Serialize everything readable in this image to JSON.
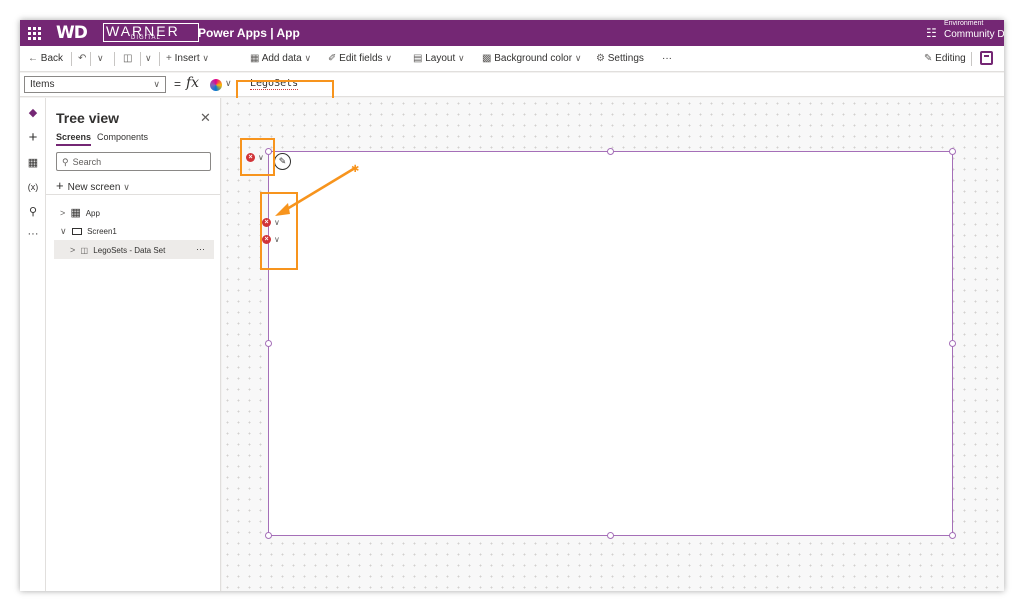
{
  "header": {
    "logo_wd": "WD",
    "logo_word": "WARNER",
    "logo_sub": "DIGITAL",
    "app_title": "Power Apps | App",
    "environment_label": "Environment",
    "environment_name": "Community Dev"
  },
  "commandbar": {
    "back": "Back",
    "insert": "Insert",
    "add_data": "Add data",
    "edit_fields": "Edit fields",
    "layout": "Layout",
    "background_color": "Background color",
    "settings": "Settings",
    "more": "···",
    "editing": "Editing"
  },
  "formulabar": {
    "property": "Items",
    "equals": "=",
    "fx": "fx",
    "formula": "LegoSets"
  },
  "treeview": {
    "title": "Tree view",
    "tabs": [
      "Screens",
      "Components"
    ],
    "search_placeholder": "Search",
    "new_screen": "New screen",
    "nodes": [
      {
        "label": "App"
      },
      {
        "label": "Screen1"
      },
      {
        "label": "LegoSets - Data Set"
      }
    ],
    "node_more": "···"
  },
  "canvas": {
    "error_symbol": "×"
  },
  "colors": {
    "header": "#742774",
    "highlight": "#f7941d",
    "error": "#d13438",
    "selection": "#a56fb8"
  }
}
